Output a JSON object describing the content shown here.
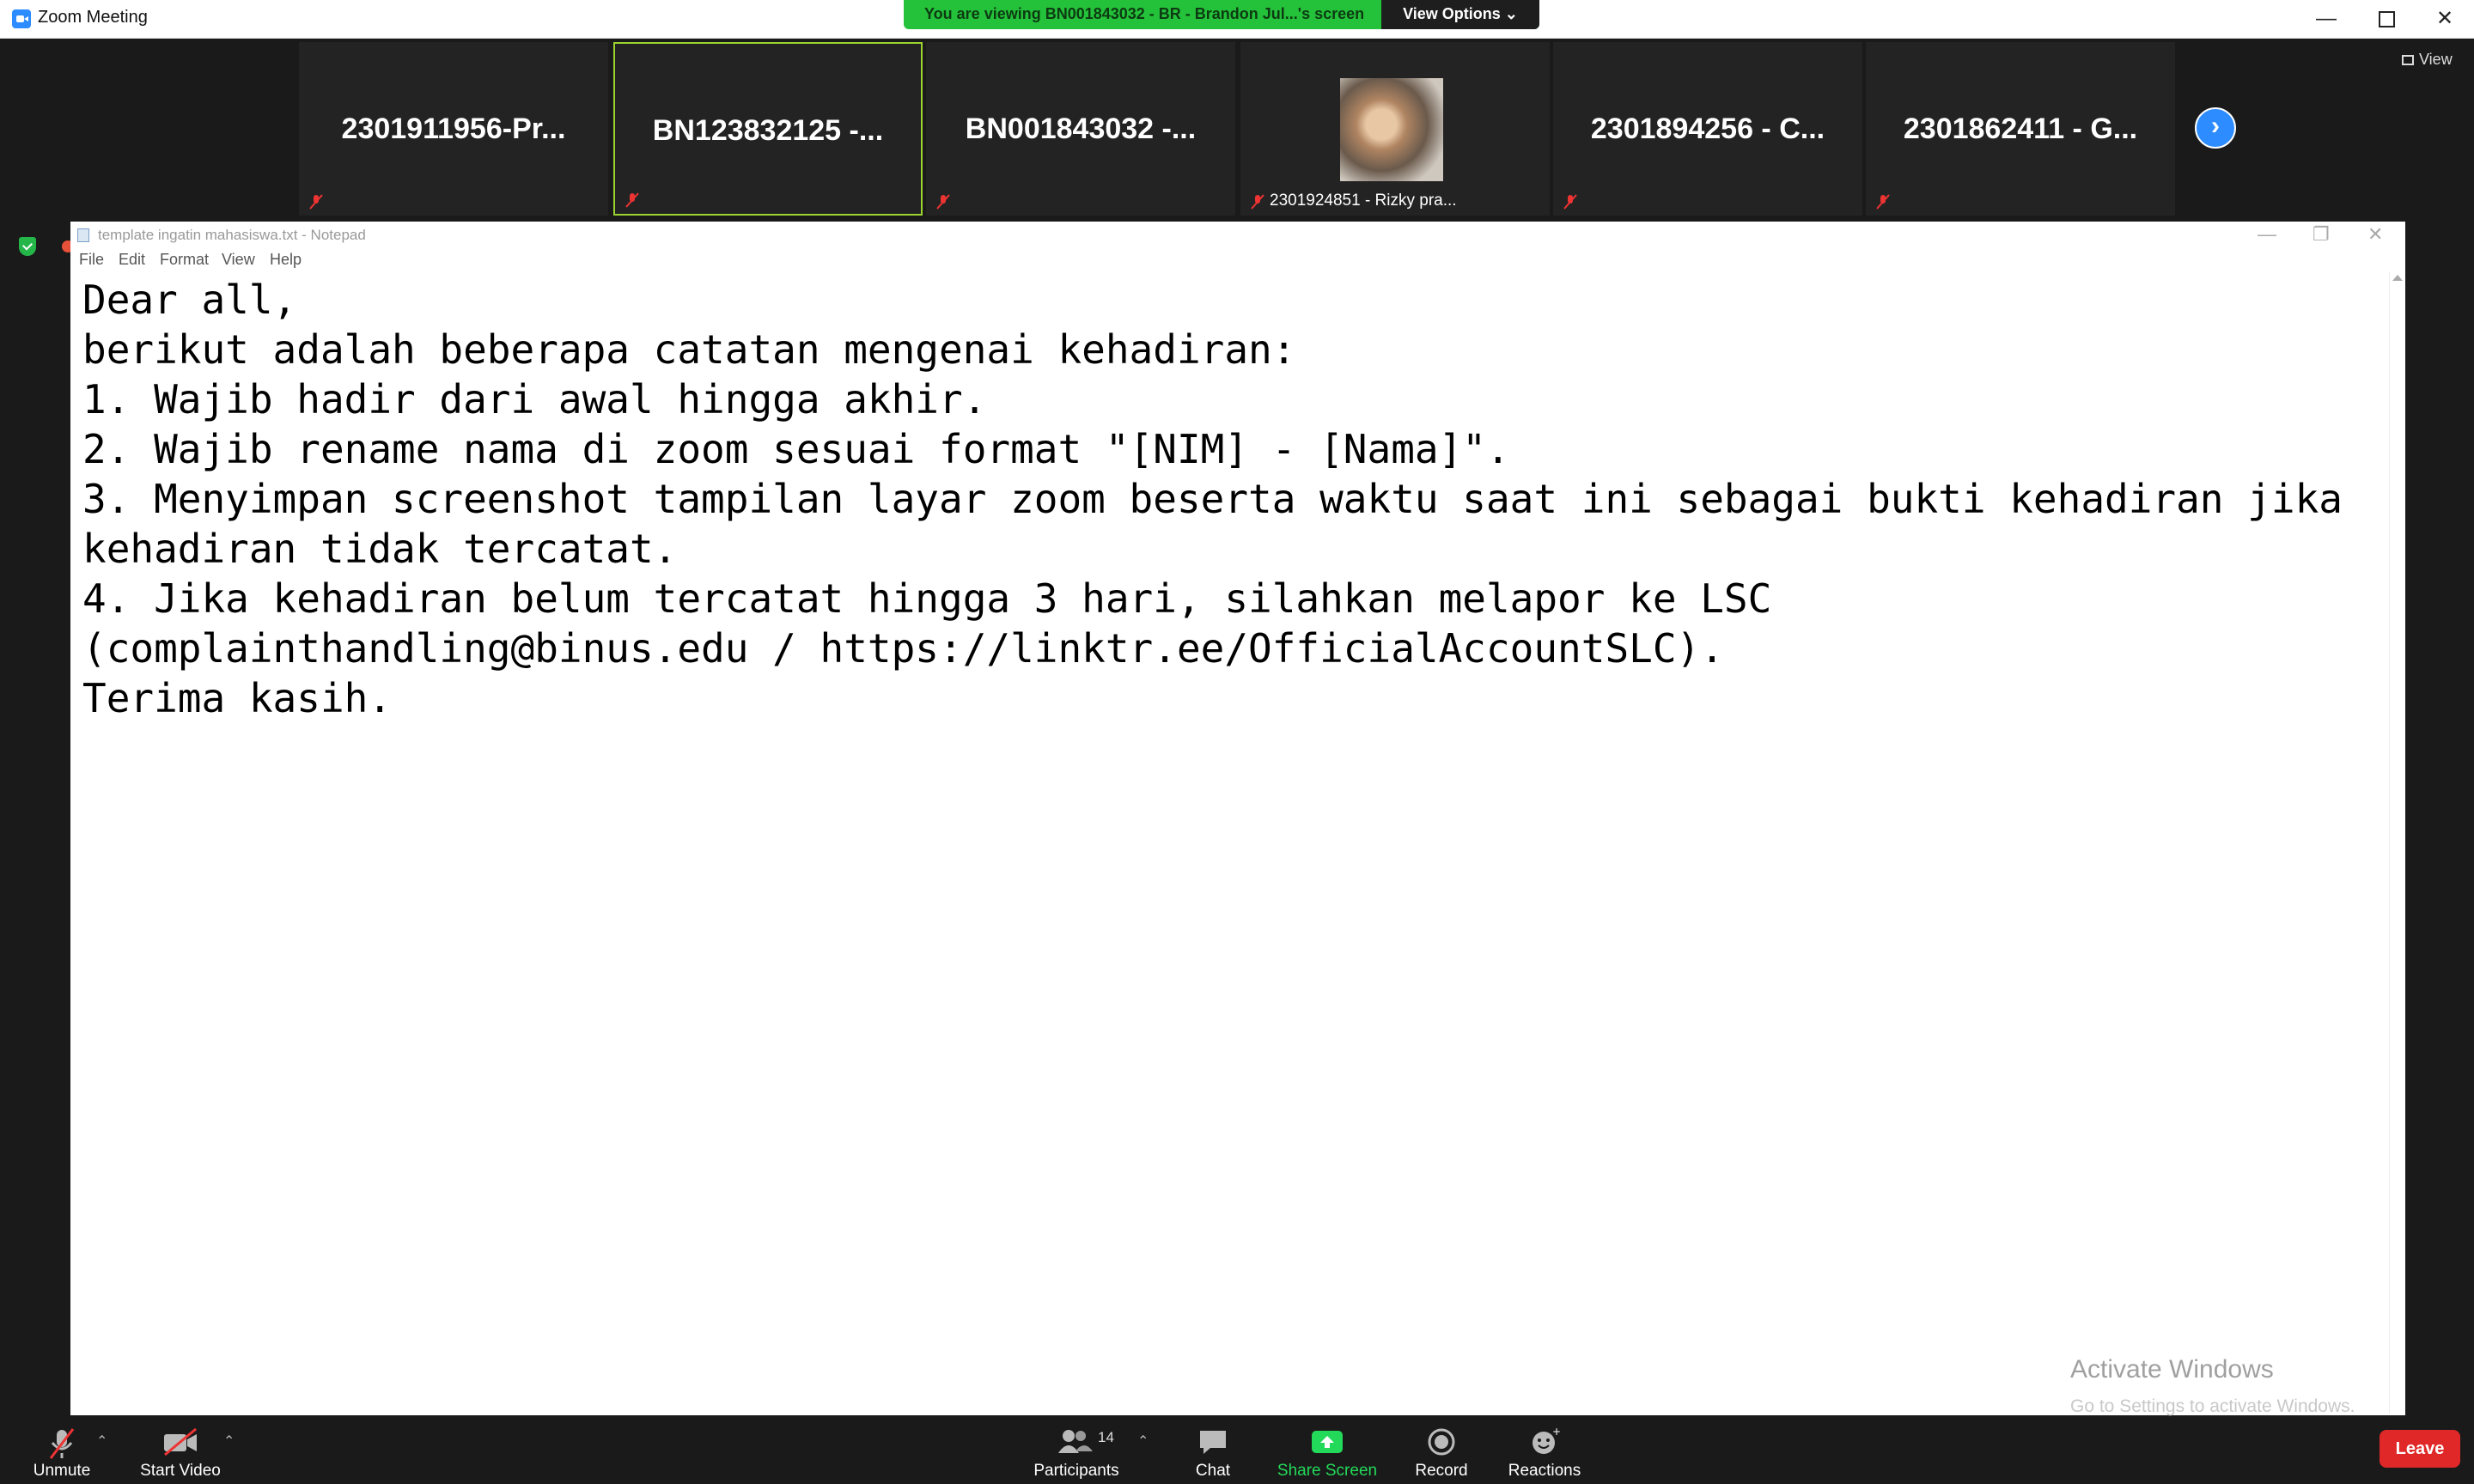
{
  "window": {
    "title": "Zoom Meeting",
    "min_glyph": "—",
    "close_glyph": "✕"
  },
  "banner": {
    "text": "You are viewing BN001843032 - BR - Brandon Jul...'s screen",
    "view_options": "View Options ⌄"
  },
  "view_label": "View",
  "participants_strip": [
    {
      "name": "2301911956-Pr..."
    },
    {
      "name": "BN123832125  -..."
    },
    {
      "name": "BN001843032  -..."
    },
    {
      "caption": "2301924851 - Rizky pra..."
    },
    {
      "name": "2301894256  - C..."
    },
    {
      "name": "2301862411  - G..."
    }
  ],
  "next_page_glyph": "›",
  "notepad": {
    "title": "template ingatin mahasiswa.txt - Notepad",
    "menu": [
      "File",
      "Edit",
      "Format",
      "View",
      "Help"
    ],
    "text": "Dear all,\nberikut adalah beberapa catatan mengenai kehadiran:\n1. Wajib hadir dari awal hingga akhir.\n2. Wajib rename nama di zoom sesuai format \"[NIM] - [Nama]\".\n3. Menyimpan screenshot tampilan layar zoom beserta waktu saat ini sebagai bukti kehadiran jika\nkehadiran tidak tercatat.\n4. Jika kehadiran belum tercatat hingga 3 hari, silahkan melapor ke LSC\n(complainthandling@binus.edu / https://linktr.ee/OfficialAccountSLC).\nTerima kasih."
  },
  "watermark": {
    "title": "Activate Windows",
    "subtitle": "Go to Settings to activate Windows."
  },
  "toolbar": {
    "unmute": "Unmute",
    "start_video": "Start Video",
    "participants": "Participants",
    "participants_count": "14",
    "chat": "Chat",
    "share_screen": "Share Screen",
    "record": "Record",
    "reactions": "Reactions",
    "leave": "Leave",
    "caret_glyph": "⌃"
  },
  "colors": {
    "accent": "#2D8CFF",
    "banner_green": "#24C23A",
    "share_green": "#23D959",
    "leave_red": "#E02828",
    "active_border": "#9BD42E"
  }
}
